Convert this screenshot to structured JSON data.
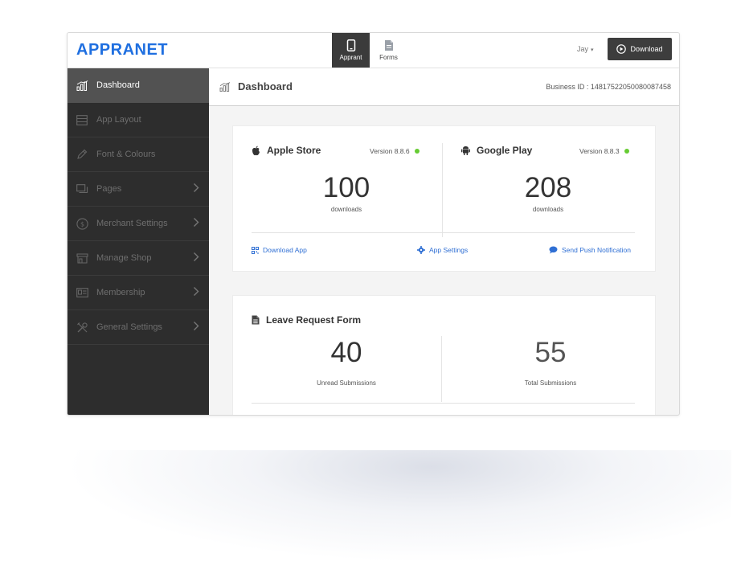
{
  "app": {
    "logo": "APPRANET"
  },
  "topnav": [
    {
      "label": "Apprant",
      "icon": "phone-icon",
      "active": true
    },
    {
      "label": "Forms",
      "icon": "document-icon",
      "active": false
    }
  ],
  "user": {
    "name": "Jay"
  },
  "download_button": {
    "label": "Download",
    "icon": "play-circle-icon"
  },
  "sidebar": {
    "items": [
      {
        "label": "Dashboard",
        "icon": "chart-icon",
        "active": true,
        "chevron": false
      },
      {
        "label": "App Layout",
        "icon": "layout-icon",
        "chevron": false
      },
      {
        "label": "Font & Colours",
        "icon": "pencil-icon",
        "chevron": false
      },
      {
        "label": "Pages",
        "icon": "pages-icon",
        "chevron": true
      },
      {
        "label": "Merchant Settings",
        "icon": "dollar-icon",
        "chevron": true
      },
      {
        "label": "Manage Shop",
        "icon": "shop-icon",
        "chevron": true
      },
      {
        "label": "Membership",
        "icon": "id-card-icon",
        "chevron": true
      },
      {
        "label": "General Settings",
        "icon": "tools-icon",
        "chevron": true
      }
    ]
  },
  "header": {
    "title": "Dashboard",
    "business_id": "Business ID : 14817522050080087458"
  },
  "stores": [
    {
      "name": "Apple Store",
      "icon": "apple-icon",
      "version": "Version 8.8.6",
      "downloads": "100",
      "downloads_label": "downloads"
    },
    {
      "name": "Google Play",
      "icon": "android-icon",
      "version": "Version 8.8.3",
      "downloads": "208",
      "downloads_label": "downloads"
    }
  ],
  "actions": {
    "download_app": "Download App",
    "app_settings": "App Settings",
    "push_notification": "Send Push Notification"
  },
  "form": {
    "title": "Leave Request Form",
    "unread": "40",
    "unread_label": "Unread Submissions",
    "total": "55",
    "total_label": "Total Submissions"
  },
  "colors": {
    "accent": "#1f6fe0",
    "link": "#2f6fd4",
    "status_ok": "#66cc33",
    "sidebar": "#2d2d2d"
  }
}
